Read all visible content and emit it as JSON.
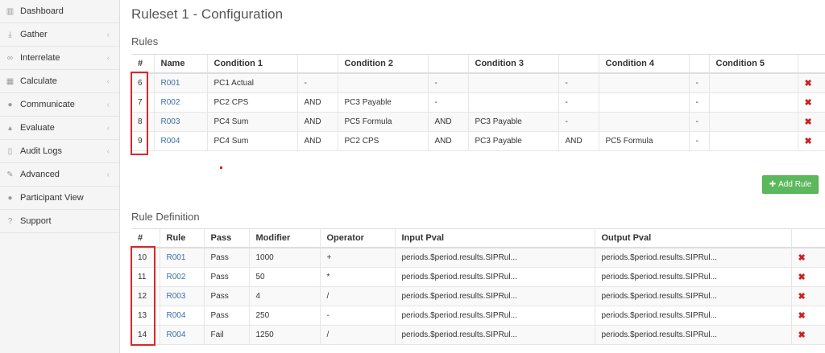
{
  "sidebar": {
    "items": [
      {
        "label": "Dashboard",
        "icon": "bar-chart-icon",
        "glyph": "▥",
        "chevron": false
      },
      {
        "label": "Gather",
        "icon": "download-icon",
        "glyph": "⤓",
        "chevron": true
      },
      {
        "label": "Interrelate",
        "icon": "link-icon",
        "glyph": "∞",
        "chevron": true
      },
      {
        "label": "Calculate",
        "icon": "calculator-icon",
        "glyph": "▦",
        "chevron": true
      },
      {
        "label": "Communicate",
        "icon": "comments-icon",
        "glyph": "●",
        "chevron": true
      },
      {
        "label": "Evaluate",
        "icon": "thumbs-up-icon",
        "glyph": "▴",
        "chevron": true
      },
      {
        "label": "Audit Logs",
        "icon": "file-icon",
        "glyph": "▯",
        "chevron": true
      },
      {
        "label": "Advanced",
        "icon": "wrench-icon",
        "glyph": "✎",
        "chevron": true
      },
      {
        "label": "Participant View",
        "icon": "user-icon",
        "glyph": "●",
        "chevron": false
      },
      {
        "label": "Support",
        "icon": "question-circle-icon",
        "glyph": "?",
        "chevron": false
      }
    ],
    "chevron_glyph": "‹"
  },
  "page": {
    "title": "Ruleset 1 - Configuration"
  },
  "rules": {
    "section_title": "Rules",
    "headers": [
      "#",
      "Name",
      "Condition 1",
      "",
      "Condition 2",
      "",
      "Condition 3",
      "",
      "Condition 4",
      "",
      "Condition 5",
      ""
    ],
    "rows": [
      {
        "num": "6",
        "name": "R001",
        "c1": "PC1 Actual",
        "op1": "-",
        "c2": "",
        "op2": "-",
        "c3": "",
        "op3": "-",
        "c4": "",
        "op4": "-",
        "c5": ""
      },
      {
        "num": "7",
        "name": "R002",
        "c1": "PC2 CPS",
        "op1": "AND",
        "c2": "PC3 Payable",
        "op2": "-",
        "c3": "",
        "op3": "-",
        "c4": "",
        "op4": "-",
        "c5": ""
      },
      {
        "num": "8",
        "name": "R003",
        "c1": "PC4 Sum",
        "op1": "AND",
        "c2": "PC5 Formula",
        "op2": "AND",
        "c3": "PC3 Payable",
        "op3": "-",
        "c4": "",
        "op4": "-",
        "c5": ""
      },
      {
        "num": "9",
        "name": "R004",
        "c1": "PC4 Sum",
        "op1": "AND",
        "c2": "PC2 CPS",
        "op2": "AND",
        "c3": "PC3 Payable",
        "op3": "AND",
        "c4": "PC5 Formula",
        "op4": "-",
        "c5": ""
      }
    ],
    "delete_glyph": "✖"
  },
  "add_rule_button": {
    "label": "Add Rule",
    "icon_glyph": "✚",
    "color": "#5cb85c"
  },
  "rule_definition": {
    "section_title": "Rule Definition",
    "headers": [
      "#",
      "Rule",
      "Pass",
      "Modifier",
      "Operator",
      "Input Pval",
      "Output Pval",
      ""
    ],
    "rows": [
      {
        "num": "10",
        "rule": "R001",
        "pass": "Pass",
        "modifier": "1000",
        "operator": "+",
        "input": "periods.$period.results.SIPRul...",
        "output": "periods.$period.results.SIPRul..."
      },
      {
        "num": "11",
        "rule": "R002",
        "pass": "Pass",
        "modifier": "50",
        "operator": "*",
        "input": "periods.$period.results.SIPRul...",
        "output": "periods.$period.results.SIPRul..."
      },
      {
        "num": "12",
        "rule": "R003",
        "pass": "Pass",
        "modifier": "4",
        "operator": "/",
        "input": "periods.$period.results.SIPRul...",
        "output": "periods.$period.results.SIPRul..."
      },
      {
        "num": "13",
        "rule": "R004",
        "pass": "Pass",
        "modifier": "250",
        "operator": "-",
        "input": "periods.$period.results.SIPRul...",
        "output": "periods.$period.results.SIPRul..."
      },
      {
        "num": "14",
        "rule": "R004",
        "pass": "Fail",
        "modifier": "1250",
        "operator": "/",
        "input": "periods.$period.results.SIPRul...",
        "output": "periods.$period.results.SIPRul..."
      }
    ],
    "delete_glyph": "✖"
  },
  "annotation_color": "#d9262b"
}
